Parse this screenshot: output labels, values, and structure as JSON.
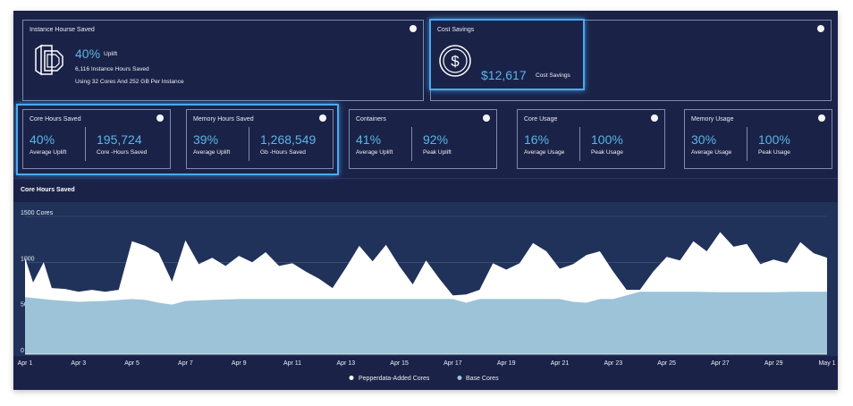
{
  "instance": {
    "title": "Instance Hourse Saved",
    "uplift_value": "40%",
    "uplift_label": "Uplift",
    "hours_line": "6,116  Instance Hours Saved",
    "config_line": "Using 32 Cores And 252 GB Per Instance",
    "icon": "server-icon"
  },
  "cost": {
    "title": "Cost Savings",
    "value": "$12,617",
    "label": "Cost Savings",
    "icon": "dollar-coin-icon"
  },
  "metrics": [
    {
      "title": "Core Hours Saved",
      "v1": "40%",
      "l1": "Average Uplift",
      "v2": "195,724",
      "l2": "Core -Hours Saved"
    },
    {
      "title": "Memory Hours Saved",
      "v1": "39%",
      "l1": "Average Uplift",
      "v2": "1,268,549",
      "l2": "Gb -Hours Saved"
    },
    {
      "title": "Containers",
      "v1": "41%",
      "l1": "Average Uplift",
      "v2": "92%",
      "l2": "Peak Uplift"
    },
    {
      "title": "Core Usage",
      "v1": "16%",
      "l1": "Average Usage",
      "v2": "100%",
      "l2": "Peak Usage"
    },
    {
      "title": "Memory Usage",
      "v1": "30%",
      "l1": "Average Usage",
      "v2": "100%",
      "l2": "Peak Usage"
    }
  ],
  "colors": {
    "accent": "#59b6e8",
    "highlight": "#4aaaf0",
    "base": "#9cc3d8",
    "added": "#ffffff",
    "background": "#1b2247"
  },
  "chart_data": {
    "type": "area",
    "title": "Core Hours Saved",
    "unit_label": "1500 Cores",
    "y_ticks": [
      "0",
      "500",
      "1000",
      "1500 Cores"
    ],
    "ylim": [
      0,
      1500
    ],
    "x_tick_labels": [
      "Apr 1",
      "Apr 3",
      "Apr 5",
      "Apr 7",
      "Apr 9",
      "Apr 11",
      "Apr 13",
      "Apr 15",
      "Apr 17",
      "Apr 19",
      "Apr 21",
      "Apr 23",
      "Apr 25",
      "Apr 27",
      "Apr 29",
      "May 1"
    ],
    "x_days": [
      0,
      2,
      4,
      6,
      8,
      10,
      12,
      14,
      16,
      18,
      20,
      22,
      24,
      26,
      28,
      30
    ],
    "legend": [
      "Pepperdata-Added Cores",
      "Base Cores"
    ],
    "legend_position": "bottom",
    "series": [
      {
        "name": "Base Cores",
        "points": [
          [
            0,
            620
          ],
          [
            1,
            590
          ],
          [
            2,
            570
          ],
          [
            3,
            580
          ],
          [
            4,
            600
          ],
          [
            4.5,
            590
          ],
          [
            5,
            560
          ],
          [
            5.5,
            540
          ],
          [
            6,
            580
          ],
          [
            7,
            590
          ],
          [
            8,
            600
          ],
          [
            9,
            600
          ],
          [
            10,
            600
          ],
          [
            11,
            600
          ],
          [
            12,
            600
          ],
          [
            13,
            600
          ],
          [
            14,
            600
          ],
          [
            15,
            600
          ],
          [
            16,
            600
          ],
          [
            16.5,
            560
          ],
          [
            17,
            600
          ],
          [
            18,
            600
          ],
          [
            19,
            600
          ],
          [
            20,
            600
          ],
          [
            20.5,
            570
          ],
          [
            21,
            560
          ],
          [
            21.5,
            600
          ],
          [
            22,
            600
          ],
          [
            22.5,
            640
          ],
          [
            23,
            680
          ],
          [
            24,
            680
          ],
          [
            25,
            680
          ],
          [
            26,
            675
          ],
          [
            27,
            675
          ],
          [
            28,
            675
          ],
          [
            29,
            680
          ],
          [
            30,
            680
          ]
        ]
      },
      {
        "name": "Pepperdata-Added Cores",
        "points": [
          [
            0,
            1050
          ],
          [
            0.3,
            780
          ],
          [
            0.7,
            1000
          ],
          [
            1,
            720
          ],
          [
            1.5,
            710
          ],
          [
            2,
            680
          ],
          [
            2.5,
            700
          ],
          [
            3,
            680
          ],
          [
            3.5,
            700
          ],
          [
            4,
            1230
          ],
          [
            4.5,
            1180
          ],
          [
            5,
            1100
          ],
          [
            5.5,
            790
          ],
          [
            6,
            1240
          ],
          [
            6.5,
            980
          ],
          [
            7,
            1050
          ],
          [
            7.5,
            960
          ],
          [
            8,
            1070
          ],
          [
            8.5,
            1000
          ],
          [
            9,
            1110
          ],
          [
            9.5,
            960
          ],
          [
            10,
            990
          ],
          [
            10.5,
            900
          ],
          [
            11,
            820
          ],
          [
            11.5,
            720
          ],
          [
            12,
            940
          ],
          [
            12.5,
            1180
          ],
          [
            13,
            1010
          ],
          [
            13.5,
            1190
          ],
          [
            14,
            960
          ],
          [
            14.5,
            760
          ],
          [
            15,
            1020
          ],
          [
            15.5,
            820
          ],
          [
            16,
            640
          ],
          [
            16.5,
            650
          ],
          [
            17,
            700
          ],
          [
            17.5,
            990
          ],
          [
            18,
            920
          ],
          [
            18.5,
            990
          ],
          [
            19,
            1210
          ],
          [
            19.5,
            1120
          ],
          [
            20,
            930
          ],
          [
            20.5,
            980
          ],
          [
            21,
            1080
          ],
          [
            21.5,
            1120
          ],
          [
            22,
            900
          ],
          [
            22.5,
            700
          ],
          [
            23,
            700
          ],
          [
            23.5,
            900
          ],
          [
            24,
            1060
          ],
          [
            24.5,
            1020
          ],
          [
            25,
            1230
          ],
          [
            25.5,
            1120
          ],
          [
            26,
            1330
          ],
          [
            26.5,
            1170
          ],
          [
            27,
            1200
          ],
          [
            27.5,
            980
          ],
          [
            28,
            1030
          ],
          [
            28.5,
            990
          ],
          [
            29,
            1220
          ],
          [
            29.5,
            1100
          ],
          [
            30,
            1050
          ]
        ]
      }
    ]
  }
}
